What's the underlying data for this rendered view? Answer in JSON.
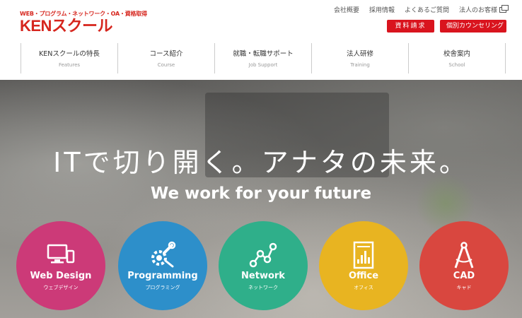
{
  "logo": {
    "tagline": "WEB・プログラム・ネットワーク・OA・資格取得",
    "name": "KENスクール"
  },
  "utility_links": [
    {
      "label": "会社概要"
    },
    {
      "label": "採用情報"
    },
    {
      "label": "よくあるご質問"
    },
    {
      "label": "法人のお客様"
    }
  ],
  "cta": {
    "request_label": "資料請求",
    "counseling_label": "個別カウンセリング"
  },
  "nav": [
    {
      "jp": "KENスクールの特長",
      "en": "Features"
    },
    {
      "jp": "コース紹介",
      "en": "Course"
    },
    {
      "jp": "就職・転職サポート",
      "en": "Job Support"
    },
    {
      "jp": "法人研修",
      "en": "Training"
    },
    {
      "jp": "校舎案内",
      "en": "School"
    }
  ],
  "hero": {
    "headline_jp": "ITで切り開く。アナタの未来。",
    "headline_en": "We work for your future"
  },
  "categories": [
    {
      "en": "Web Design",
      "kana": "ウェブデザイン",
      "icon": "devices-icon",
      "color": "#cc3a78"
    },
    {
      "en": "Programming",
      "kana": "プログラミング",
      "icon": "gear-wrench-icon",
      "color": "#2d8fca"
    },
    {
      "en": "Network",
      "kana": "ネットワーク",
      "icon": "network-icon",
      "color": "#2faf8a"
    },
    {
      "en": "Office",
      "kana": "オフィス",
      "icon": "document-chart-icon",
      "color": "#e8b421"
    },
    {
      "en": "CAD",
      "kana": "キャド",
      "icon": "compass-icon",
      "color": "#d9473f"
    }
  ]
}
